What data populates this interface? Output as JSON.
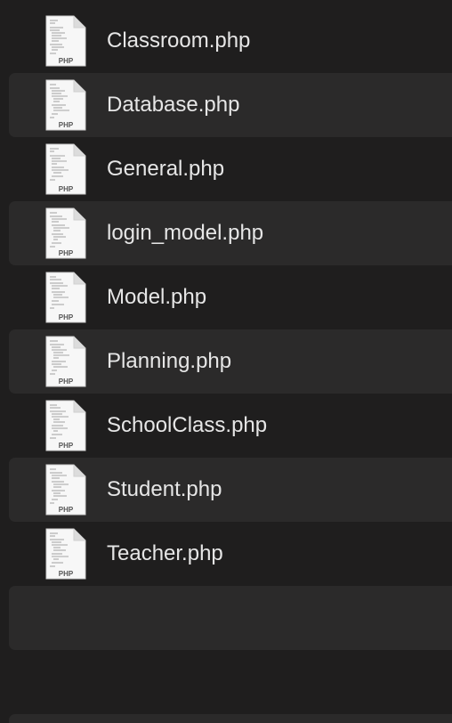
{
  "files": [
    {
      "name": "Classroom.php",
      "icon": "php-file-icon",
      "badge": "PHP"
    },
    {
      "name": "Database.php",
      "icon": "php-file-icon",
      "badge": "PHP"
    },
    {
      "name": "General.php",
      "icon": "php-file-icon",
      "badge": "PHP"
    },
    {
      "name": "login_model.php",
      "icon": "php-file-icon",
      "badge": "PHP"
    },
    {
      "name": "Model.php",
      "icon": "php-file-icon",
      "badge": "PHP"
    },
    {
      "name": "Planning.php",
      "icon": "php-file-icon",
      "badge": "PHP"
    },
    {
      "name": "SchoolClass.php",
      "icon": "php-file-icon",
      "badge": "PHP"
    },
    {
      "name": "Student.php",
      "icon": "php-file-icon",
      "badge": "PHP"
    },
    {
      "name": "Teacher.php",
      "icon": "php-file-icon",
      "badge": "PHP"
    }
  ],
  "colors": {
    "background": "#1f1e1e",
    "row_stripe": "#2b2a2a",
    "text": "#e6e6e6"
  }
}
